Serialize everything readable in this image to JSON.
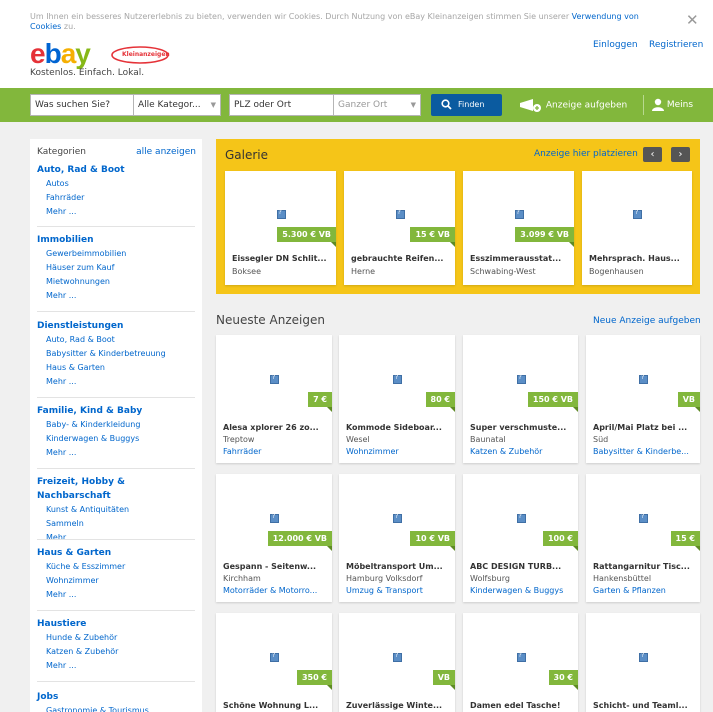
{
  "cookie": {
    "text": "Um Ihnen ein besseres Nutzererlebnis zu bieten, verwenden wir Cookies. Durch Nutzung von eBay Kleinanzeigen stimmen Sie unserer",
    "link": "Verwendung von Cookies",
    "suffix": "zu.",
    "close": "✕"
  },
  "header": {
    "logo_text": "ebay",
    "logo_badge": "Kleinanzeigen",
    "slogan": "Kostenlos. Einfach. Lokal.",
    "login": "Einloggen",
    "register": "Registrieren"
  },
  "search": {
    "query_placeholder": "Was suchen Sie?",
    "category": "Alle Kategor...",
    "location_placeholder": "PLZ oder Ort",
    "radius": "Ganzer Ort",
    "find": "Finden",
    "post_ad": "Anzeige aufgeben",
    "mine": "Meins"
  },
  "sidebar": {
    "heading": "Kategorien",
    "show_all": "alle anzeigen",
    "groups": [
      {
        "title": "Auto, Rad & Boot",
        "items": [
          "Autos",
          "Fahrräder",
          "Mehr ..."
        ]
      },
      {
        "title": "Immobilien",
        "items": [
          "Gewerbeimmobilien",
          "Häuser zum Kauf",
          "Mietwohnungen",
          "Mehr ..."
        ]
      },
      {
        "title": "Dienstleistungen",
        "items": [
          "Auto, Rad & Boot",
          "Babysitter & Kinderbetreuung",
          "Haus & Garten",
          "Mehr ..."
        ]
      },
      {
        "title": "Familie, Kind & Baby",
        "items": [
          "Baby- & Kinderkleidung",
          "Kinderwagen & Buggys",
          "Mehr ..."
        ]
      },
      {
        "title": "Freizeit, Hobby & Nachbarschaft",
        "items": [
          "Kunst & Antiquitäten",
          "Sammeln",
          "Mehr ..."
        ]
      },
      {
        "title": "Haus & Garten",
        "items": [
          "Küche & Esszimmer",
          "Wohnzimmer",
          "Mehr ..."
        ]
      },
      {
        "title": "Haustiere",
        "items": [
          "Hunde & Zubehör",
          "Katzen & Zubehör",
          "Mehr ..."
        ]
      },
      {
        "title": "Jobs",
        "items": [
          "Gastronomie & Tourismus"
        ]
      }
    ]
  },
  "gallery": {
    "title": "Galerie",
    "link": "Anzeige hier platzieren",
    "prev": "‹",
    "next": "›",
    "cards": [
      {
        "price": "5.300 € VB",
        "title": "Eissegler DN Schlit...",
        "location": "Boksee"
      },
      {
        "price": "15 € VB",
        "title": "gebrauchte Reifen...",
        "location": "Herne"
      },
      {
        "price": "3.099 € VB",
        "title": "Esszimmerausstat...",
        "location": "Schwabing-West"
      },
      {
        "price": "",
        "title": "Mehrsprach. Haus...",
        "location": "Bogenhausen"
      }
    ]
  },
  "latest": {
    "title": "Neueste Anzeigen",
    "link": "Neue Anzeige aufgeben",
    "cards": [
      {
        "price": "7 €",
        "title": "Alesa xplorer 26 zo...",
        "location": "Treptow",
        "category": "Fahrräder"
      },
      {
        "price": "80 €",
        "title": "Kommode Sideboar...",
        "location": "Wesel",
        "category": "Wohnzimmer"
      },
      {
        "price": "150 € VB",
        "title": "Super verschmuste...",
        "location": "Baunatal",
        "category": "Katzen & Zubehör"
      },
      {
        "price": "VB",
        "title": "April/Mai Platz bei ...",
        "location": "Süd",
        "category": "Babysitter & Kinderbe..."
      },
      {
        "price": "12.000 € VB",
        "title": "Gespann - Seitenw...",
        "location": "Kirchham",
        "category": "Motorräder & Motorro..."
      },
      {
        "price": "10 € VB",
        "title": "Möbeltransport Um...",
        "location": "Hamburg Volksdorf",
        "category": "Umzug & Transport"
      },
      {
        "price": "100 €",
        "title": "ABC DESIGN TURB...",
        "location": "Wolfsburg",
        "category": "Kinderwagen & Buggys"
      },
      {
        "price": "15 €",
        "title": "Rattangarnitur Tisc...",
        "location": "Hankensbüttel",
        "category": "Garten & Pflanzen"
      },
      {
        "price": "350 €",
        "title": "Schöne Wohnung L...",
        "location": "",
        "category": ""
      },
      {
        "price": "VB",
        "title": "Zuverlässige Winte...",
        "location": "",
        "category": ""
      },
      {
        "price": "30 €",
        "title": "Damen edel Tasche!",
        "location": "",
        "category": ""
      },
      {
        "price": "",
        "title": "Schicht- und Teaml...",
        "location": "",
        "category": ""
      }
    ]
  },
  "colors": {
    "accent_green": "#82b73c",
    "gallery_yellow": "#f5c518",
    "link_blue": "#0066cc",
    "button_blue": "#0b5ba0"
  }
}
